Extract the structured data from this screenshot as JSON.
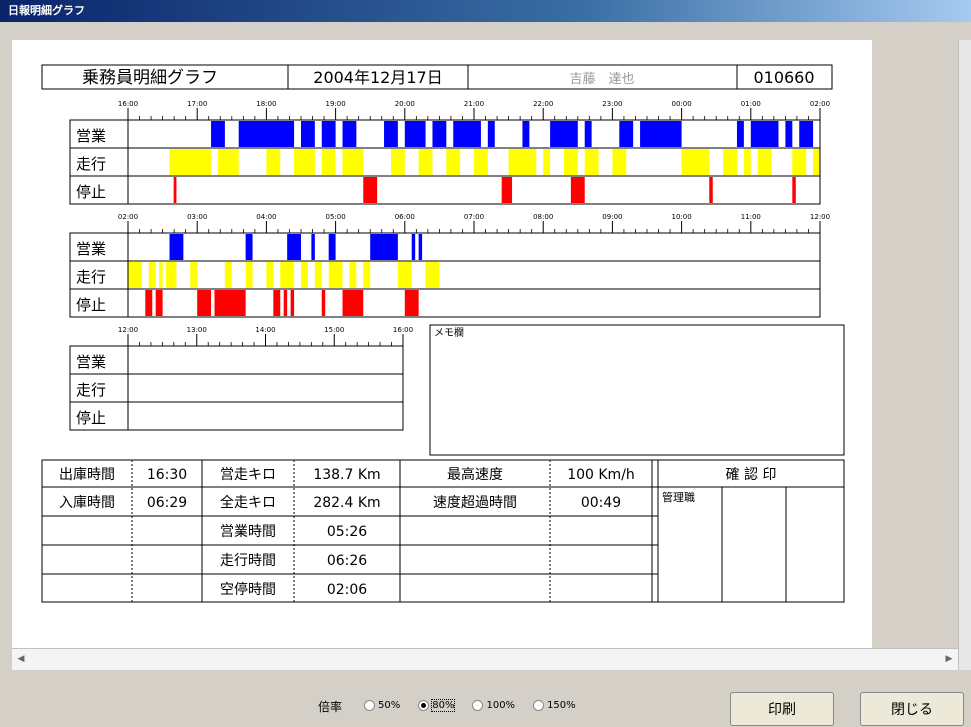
{
  "window": {
    "title": "日報明細グラフ"
  },
  "header": {
    "title": "乗務員明細グラフ",
    "date": "2004年12月17日",
    "name": "吉藤　達也",
    "id": "010660"
  },
  "rows": [
    "営業",
    "走行",
    "停止"
  ],
  "timeline1": {
    "ticks": [
      "16:00",
      "17:00",
      "18:00",
      "19:00",
      "20:00",
      "21:00",
      "22:00",
      "23:00",
      "00:00",
      "01:00",
      "02:00"
    ]
  },
  "timeline2": {
    "ticks": [
      "02:00",
      "03:00",
      "04:00",
      "05:00",
      "06:00",
      "07:00",
      "08:00",
      "09:00",
      "10:00",
      "11:00",
      "12:00"
    ]
  },
  "timeline3": {
    "ticks": [
      "12:00",
      "13:00",
      "14:00",
      "15:00",
      "16:00"
    ]
  },
  "memo": {
    "label": "メモ欄"
  },
  "stats": {
    "depart_label": "出庫時間",
    "depart_value": "16:30",
    "return_label": "入庫時間",
    "return_value": "06:29",
    "business_km_label": "営走キロ",
    "business_km_value": "138.7 Km",
    "total_km_label": "全走キロ",
    "total_km_value": "282.4 Km",
    "max_speed_label": "最高速度",
    "max_speed_value": "100 Km/h",
    "overspeed_label": "速度超過時間",
    "overspeed_value": "00:49",
    "business_time_label": "営業時間",
    "business_time_value": "05:26",
    "run_time_label": "走行時間",
    "run_time_value": "06:26",
    "idle_time_label": "空停時間",
    "idle_time_value": "02:06",
    "confirm_label": "確 認 印",
    "manager_label": "管理職"
  },
  "bars": {
    "t1": {
      "business": [
        [
          0.12,
          0.14
        ],
        [
          0.16,
          0.24
        ],
        [
          0.25,
          0.27
        ],
        [
          0.28,
          0.3
        ],
        [
          0.31,
          0.33
        ],
        [
          0.37,
          0.39
        ],
        [
          0.4,
          0.43
        ],
        [
          0.44,
          0.46
        ],
        [
          0.47,
          0.51
        ],
        [
          0.52,
          0.53
        ],
        [
          0.57,
          0.58
        ],
        [
          0.61,
          0.65
        ],
        [
          0.66,
          0.67
        ],
        [
          0.71,
          0.73
        ],
        [
          0.74,
          0.8
        ],
        [
          0.88,
          0.89
        ],
        [
          0.9,
          0.94
        ],
        [
          0.95,
          0.96
        ],
        [
          0.97,
          0.99
        ],
        [
          1.0,
          1.03
        ],
        [
          1.05,
          1.07
        ],
        [
          1.08,
          1.09
        ],
        [
          1.1,
          1.12
        ]
      ],
      "running": [
        [
          0.06,
          0.12
        ],
        [
          0.13,
          0.16
        ],
        [
          0.2,
          0.22
        ],
        [
          0.24,
          0.27
        ],
        [
          0.28,
          0.3
        ],
        [
          0.31,
          0.34
        ],
        [
          0.38,
          0.4
        ],
        [
          0.42,
          0.44
        ],
        [
          0.46,
          0.48
        ],
        [
          0.5,
          0.52
        ],
        [
          0.55,
          0.59
        ],
        [
          0.6,
          0.61
        ],
        [
          0.63,
          0.65
        ],
        [
          0.66,
          0.68
        ],
        [
          0.7,
          0.72
        ],
        [
          0.8,
          0.84
        ],
        [
          0.86,
          0.88
        ],
        [
          0.89,
          0.9
        ],
        [
          0.91,
          0.93
        ],
        [
          0.96,
          0.98
        ],
        [
          0.99,
          1.0
        ],
        [
          1.03,
          1.06
        ],
        [
          1.07,
          1.08
        ],
        [
          1.09,
          1.12
        ]
      ],
      "stop": [
        [
          0.066,
          0.07
        ],
        [
          0.34,
          0.36
        ],
        [
          0.54,
          0.555
        ],
        [
          0.64,
          0.66
        ],
        [
          0.84,
          0.845
        ],
        [
          0.96,
          0.965
        ]
      ]
    },
    "t2": {
      "business": [
        [
          0.06,
          0.08
        ],
        [
          0.17,
          0.18
        ],
        [
          0.23,
          0.25
        ],
        [
          0.265,
          0.27
        ],
        [
          0.29,
          0.3
        ],
        [
          0.35,
          0.39
        ],
        [
          0.41,
          0.415
        ],
        [
          0.42,
          0.425
        ]
      ],
      "running": [
        [
          0.0,
          0.02
        ],
        [
          0.03,
          0.04
        ],
        [
          0.045,
          0.05
        ],
        [
          0.055,
          0.07
        ],
        [
          0.09,
          0.1
        ],
        [
          0.14,
          0.15
        ],
        [
          0.17,
          0.18
        ],
        [
          0.2,
          0.21
        ],
        [
          0.22,
          0.24
        ],
        [
          0.25,
          0.26
        ],
        [
          0.27,
          0.28
        ],
        [
          0.29,
          0.31
        ],
        [
          0.32,
          0.33
        ],
        [
          0.34,
          0.35
        ],
        [
          0.39,
          0.41
        ],
        [
          0.43,
          0.45
        ]
      ],
      "stop": [
        [
          0.025,
          0.035
        ],
        [
          0.04,
          0.05
        ],
        [
          0.1,
          0.12
        ],
        [
          0.125,
          0.17
        ],
        [
          0.21,
          0.22
        ],
        [
          0.225,
          0.23
        ],
        [
          0.235,
          0.24
        ],
        [
          0.28,
          0.285
        ],
        [
          0.31,
          0.34
        ],
        [
          0.4,
          0.42
        ]
      ]
    }
  },
  "bottom": {
    "zoom_label": "倍率",
    "zoom_options": [
      "50%",
      "80%",
      "100%",
      "150%"
    ],
    "zoom_selected": "80%",
    "print_button": "印刷",
    "close_button": "閉じる"
  },
  "colors": {
    "business": "#0000ff",
    "running": "#ffff00",
    "stop": "#ff0000"
  }
}
